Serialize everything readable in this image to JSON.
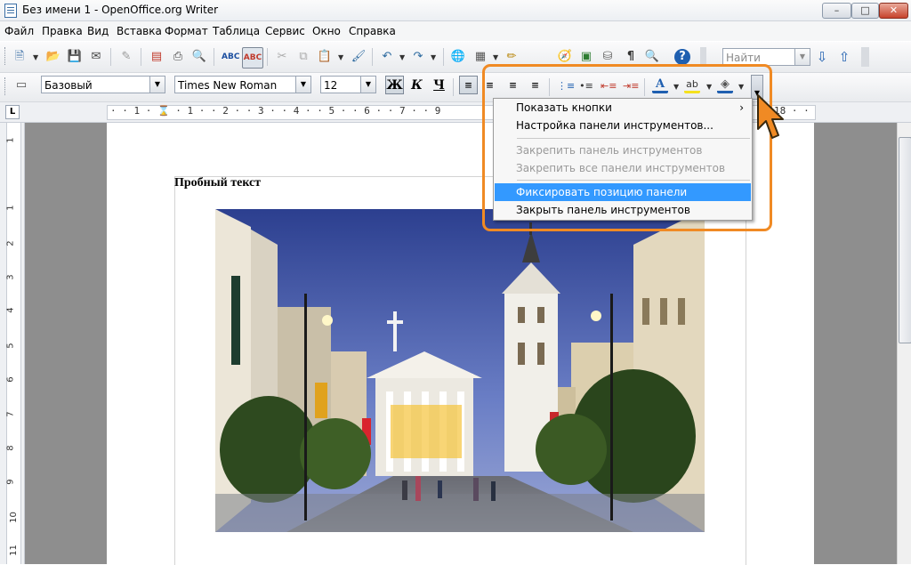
{
  "window": {
    "title": "Без имени 1 - OpenOffice.org Writer",
    "minimize": "–",
    "maximize": "□",
    "close": "✕"
  },
  "menu": [
    "Файл",
    "Правка",
    "Вид",
    "Вставка",
    "Формат",
    "Таблица",
    "Сервис",
    "Окно",
    "Справка"
  ],
  "find": {
    "placeholder": "Найти"
  },
  "format": {
    "style": "Базовый",
    "font": "Times New Roman",
    "size": "12",
    "bold": "Ж",
    "italic": "К",
    "underline": "Ч"
  },
  "ruler": {
    "corner": "L",
    "scale": "· · 1 · ⌛ · 1 · · 2 · · 3 · · 4 · · 5 · · 6 · · 7 · · 9",
    "tail": "18 · ·",
    "left_scale": [
      "1",
      "1",
      "2",
      "3",
      "4",
      "5",
      "6",
      "7",
      "8",
      "9",
      "10",
      "11"
    ]
  },
  "document": {
    "text": "Пробный текст"
  },
  "context_menu": {
    "items": [
      {
        "label": "Показать кнопки",
        "submenu": true,
        "state": "enabled"
      },
      {
        "label": "Настройка панели инструментов...",
        "state": "enabled"
      },
      {
        "label": "Закрепить панель инструментов",
        "state": "disabled"
      },
      {
        "label": "Закрепить все панели инструментов",
        "state": "disabled"
      },
      {
        "label": "Фиксировать позицию панели инструментов",
        "state": "selected"
      },
      {
        "label": "Закрыть панель инструментов",
        "state": "enabled"
      }
    ],
    "submenu_arrow": "›"
  },
  "colors": {
    "accent": "#f08a24",
    "selection": "#3399ff",
    "workspace": "#8e8e8e"
  }
}
